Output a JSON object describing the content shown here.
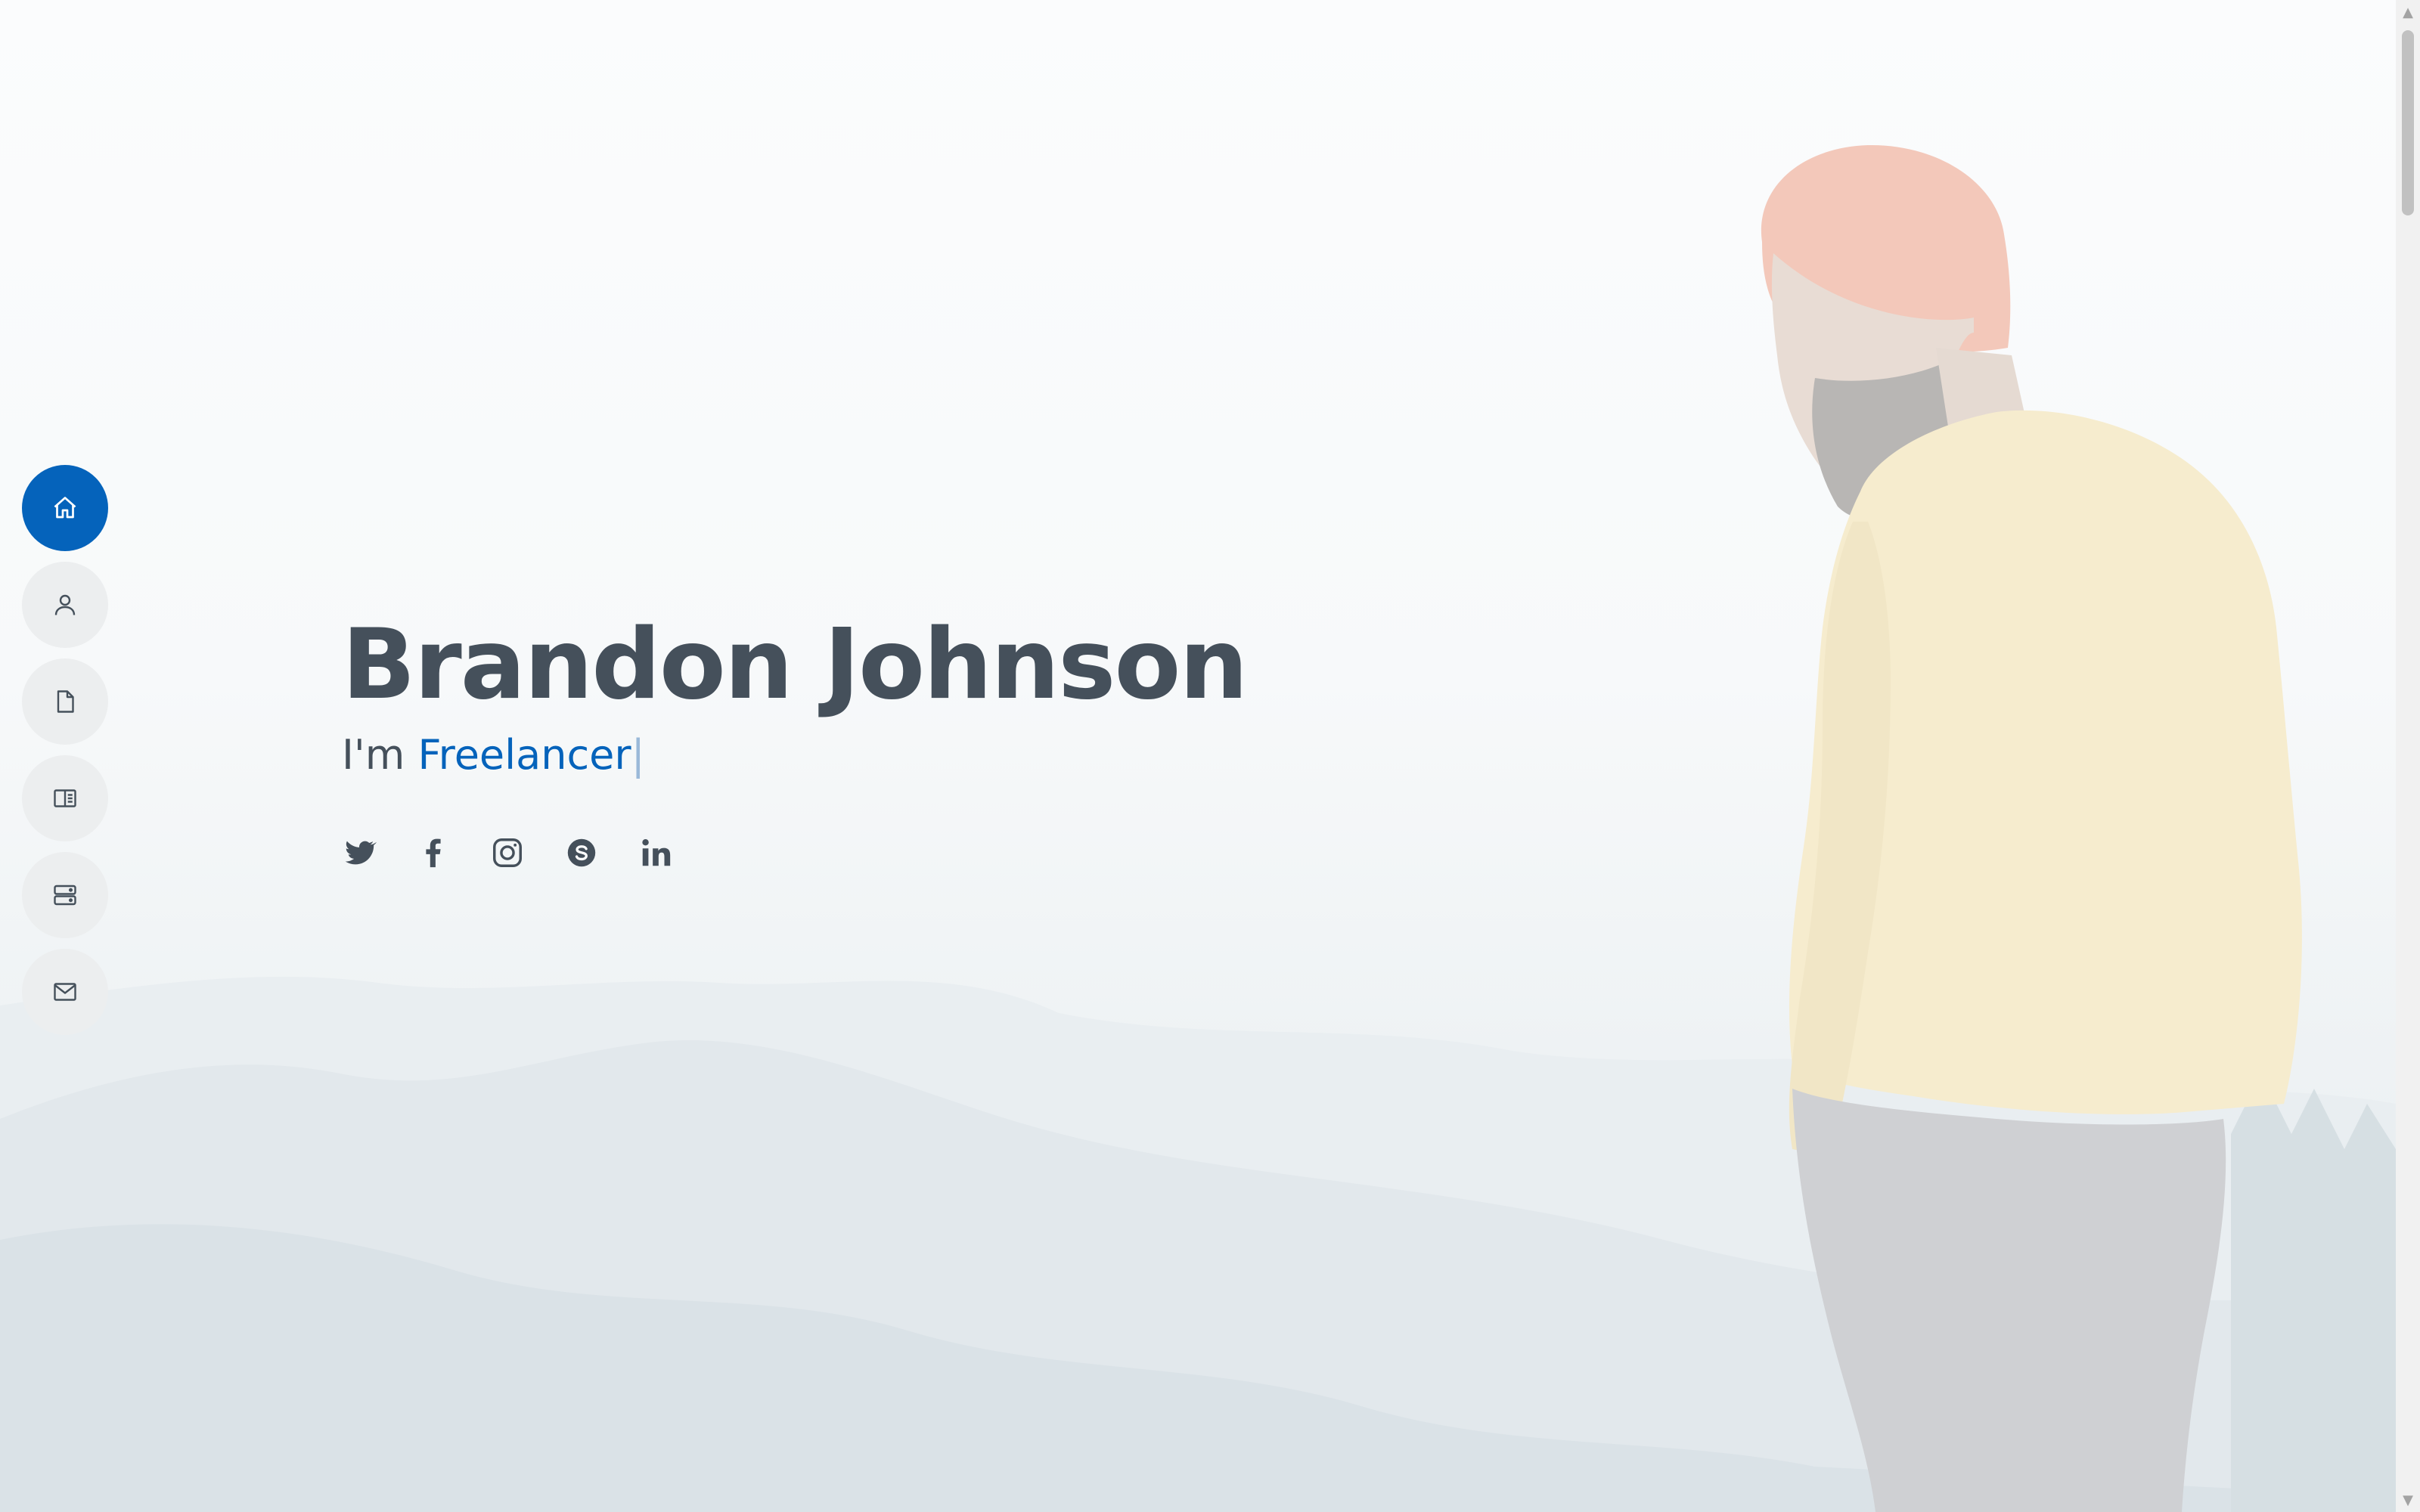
{
  "hero": {
    "name": "Brandon Johnson",
    "role_prefix": "I'm",
    "role_typed": "Freelancer",
    "cursor": "|"
  },
  "nav": {
    "items": [
      {
        "id": "home",
        "icon": "house-icon",
        "active": true
      },
      {
        "id": "about",
        "icon": "person-icon",
        "active": false
      },
      {
        "id": "resume",
        "icon": "file-icon",
        "active": false
      },
      {
        "id": "portfolio",
        "icon": "book-half-icon",
        "active": false
      },
      {
        "id": "services",
        "icon": "server-icon",
        "active": false
      },
      {
        "id": "contact",
        "icon": "envelope-icon",
        "active": false
      }
    ]
  },
  "social": [
    "twitter-icon",
    "facebook-icon",
    "instagram-icon",
    "skype-icon",
    "linkedin-icon"
  ],
  "colors": {
    "accent": "#0563bb",
    "text": "#45505b",
    "nav_bg": "#eceeef"
  }
}
